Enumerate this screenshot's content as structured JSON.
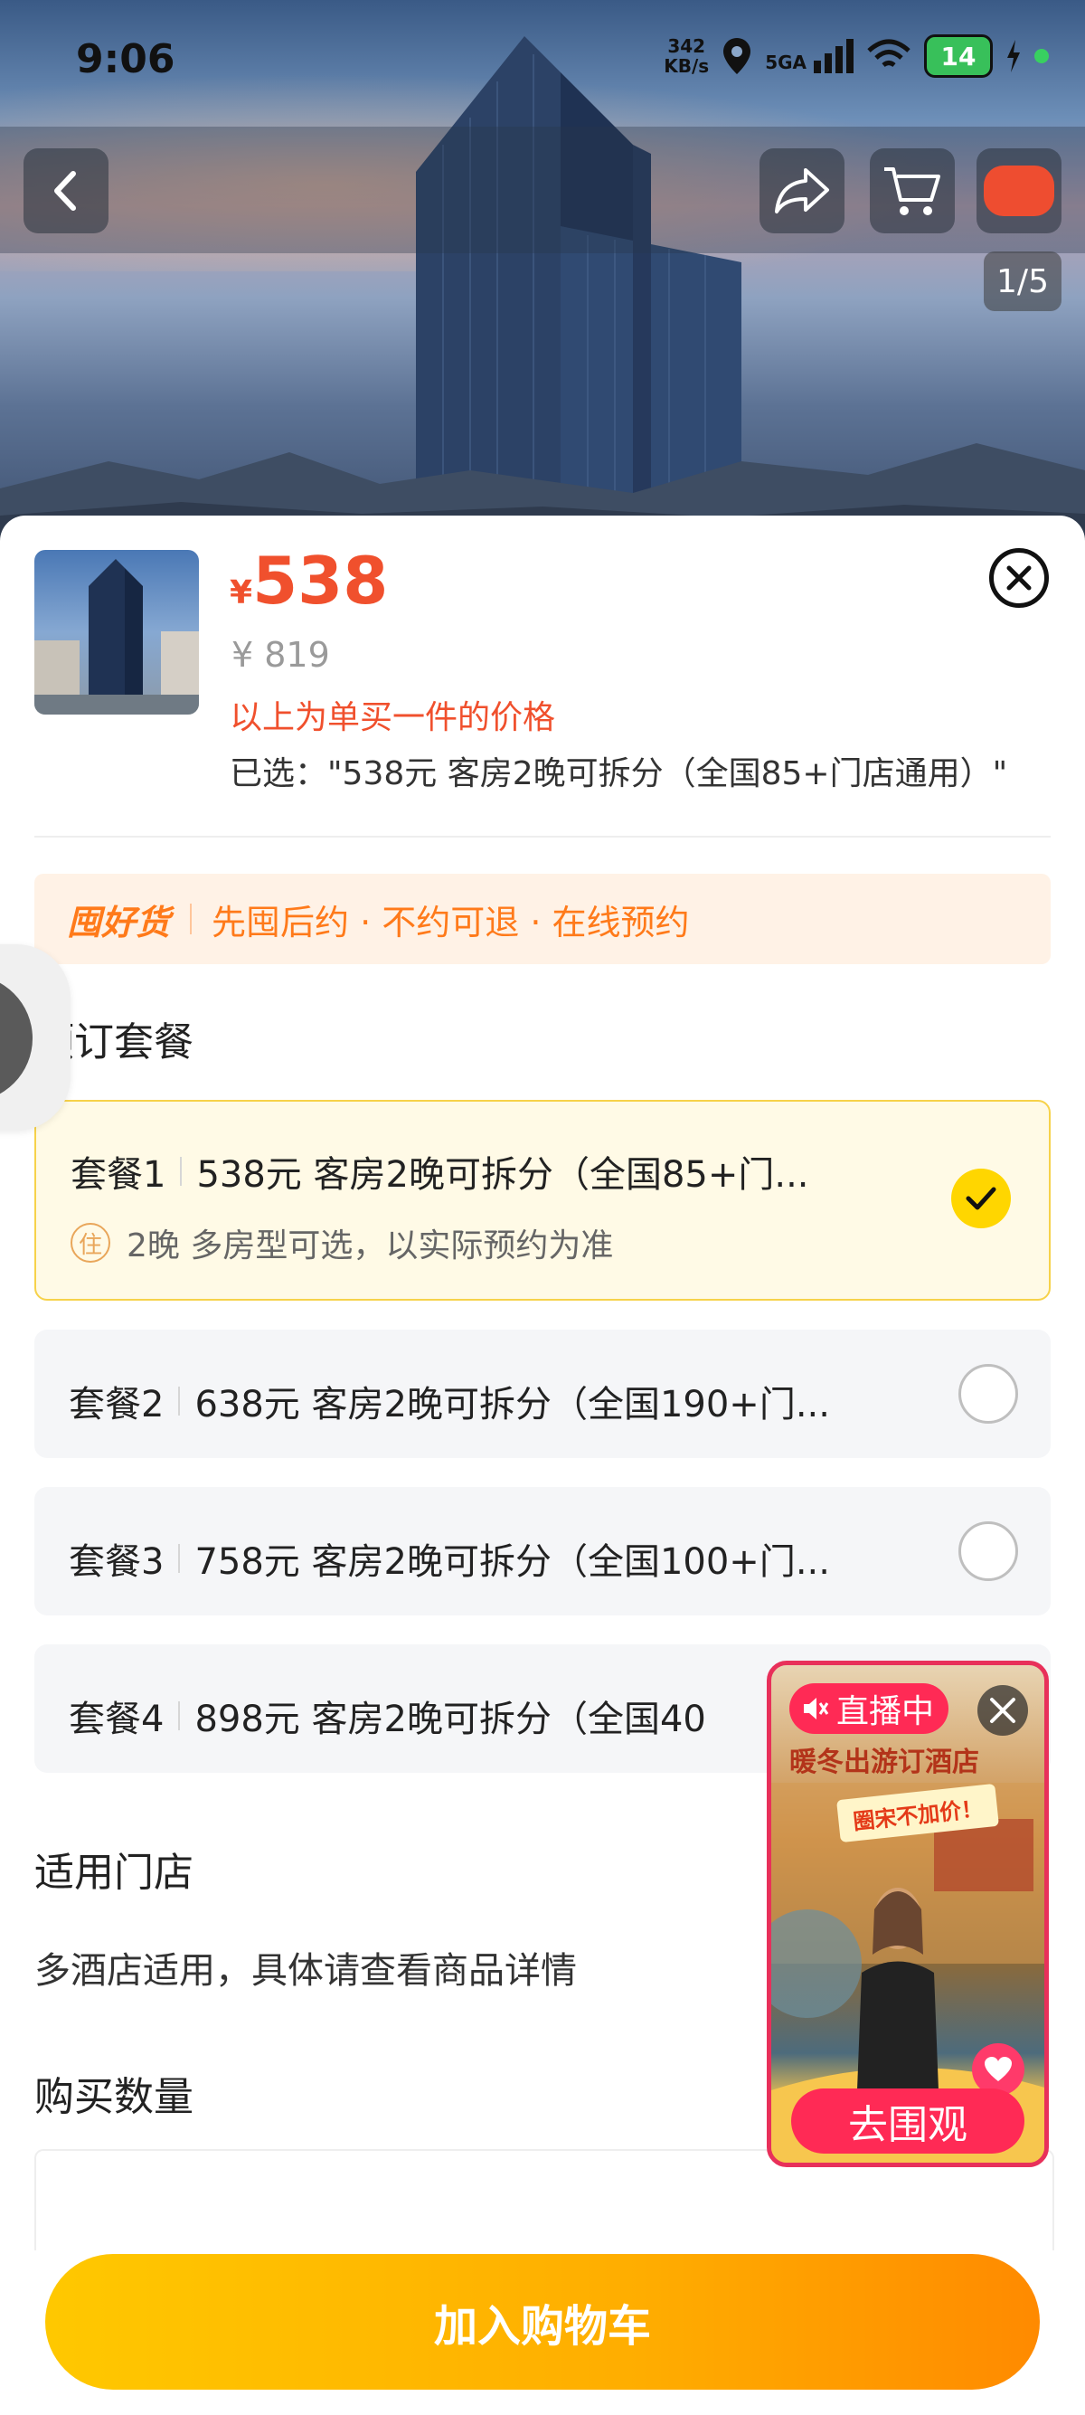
{
  "status_bar": {
    "time": "9:06",
    "net_speed_value": "342",
    "net_speed_unit": "KB/s",
    "network": "5GA",
    "battery": "14"
  },
  "hero": {
    "image_counter": "1/5"
  },
  "product": {
    "currency": "¥",
    "price": "538",
    "original_price": "¥ 819",
    "single_price_note": "以上为单买一件的价格",
    "selected_text": "已选：\"538元 客房2晚可拆分（全国85+门店通用）\""
  },
  "promo": {
    "brand": "囤好货",
    "text": "先囤后约 · 不约可退 · 在线预约"
  },
  "packages_title": "预订套餐",
  "packages": [
    {
      "name": "套餐1",
      "desc": "538元 客房2晚可拆分（全国85+门...",
      "sub": "2晚 多房型可选，以实际预约为准",
      "sub_icon": "住",
      "selected": true
    },
    {
      "name": "套餐2",
      "desc": "638元 客房2晚可拆分（全国190+门...",
      "selected": false
    },
    {
      "name": "套餐3",
      "desc": "758元 客房2晚可拆分（全国100+门...",
      "selected": false
    },
    {
      "name": "套餐4",
      "desc": "898元 客房2晚可拆分（全国40",
      "selected": false
    }
  ],
  "stores": {
    "title": "适用门店",
    "desc": "多酒店适用，具体请查看商品详情"
  },
  "quantity": {
    "title": "购买数量"
  },
  "cart_button": "加入购物车",
  "live": {
    "badge": "直播中",
    "title": "暖冬出游订酒店",
    "ribbon": "圈宋不加价！",
    "cta": "去围观"
  },
  "colors": {
    "price": "#f0502d",
    "promo": "#ff7a1a",
    "cart_start": "#ffc800",
    "cart_end": "#ff8a00",
    "live": "#ff2a55",
    "check": "#ffd600"
  }
}
